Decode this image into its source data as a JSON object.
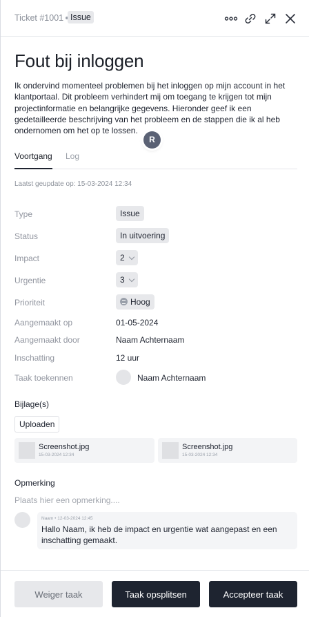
{
  "header": {
    "ticket_id": "Ticket #1001",
    "type_chip": "Issue",
    "icons": [
      "more-icon",
      "link-icon",
      "expand-icon",
      "close-icon"
    ]
  },
  "ticket": {
    "title": "Fout bij inloggen",
    "description": "Ik ondervind momenteel problemen bij het inloggen op mijn account in het klantportaal. Dit probleem verhindert mij om toegang te krijgen tot mijn projectinformatie en belangrijke gegevens. Hieronder geef ik een gedetailleerde beschrijving van het probleem en de stappen die ik al heb ondernomen om het op te lossen.",
    "cursor_avatar_initial": "R"
  },
  "tabs": [
    {
      "label": "Voortgang",
      "active": true
    },
    {
      "label": "Log",
      "active": false
    }
  ],
  "updated": "Laatst geupdate op: 15-03-2024 12:34",
  "properties": {
    "type": {
      "label": "Type",
      "value": "Issue"
    },
    "status": {
      "label": "Status",
      "value": "In uitvoering"
    },
    "impact": {
      "label": "Impact",
      "value": "2"
    },
    "urgency": {
      "label": "Urgentie",
      "value": "3"
    },
    "priority": {
      "label": "Prioriteit",
      "value": "Hoog"
    },
    "created_on": {
      "label": "Aangemaakt op",
      "value": "01-05-2024"
    },
    "created_by": {
      "label": "Aangemaakt door",
      "value": "Naam Achternaam"
    },
    "estimate": {
      "label": "Inschatting",
      "value": "12 uur"
    },
    "assign": {
      "label": "Taak toekennen",
      "value": "Naam Achternaam"
    }
  },
  "attachments": {
    "title": "Bijlage(s)",
    "upload_label": "Uploaden",
    "files": [
      {
        "name": "Screenshot.jpg",
        "date": "15-03-2024 12:34"
      },
      {
        "name": "Screenshot.jpg",
        "date": "15-03-2024 12:34"
      }
    ]
  },
  "comments": {
    "title": "Opmerking",
    "placeholder": "Plaats hier een opmerking....",
    "items": [
      {
        "meta": "Naam • 12-03-2024 12:45",
        "text": "Hallo Naam, ik heb de impact en urgentie wat aangepast en een inschatting gemaakt."
      }
    ]
  },
  "footer": {
    "reject_label": "Weiger taak",
    "split_label": "Taak opsplitsen",
    "accept_label": "Accepteer taak"
  },
  "colors": {
    "primary_button": "#1e2430",
    "secondary_button": "#e7e8eb",
    "chip_bg": "#e7e8eb",
    "muted_text": "#9296a0"
  }
}
